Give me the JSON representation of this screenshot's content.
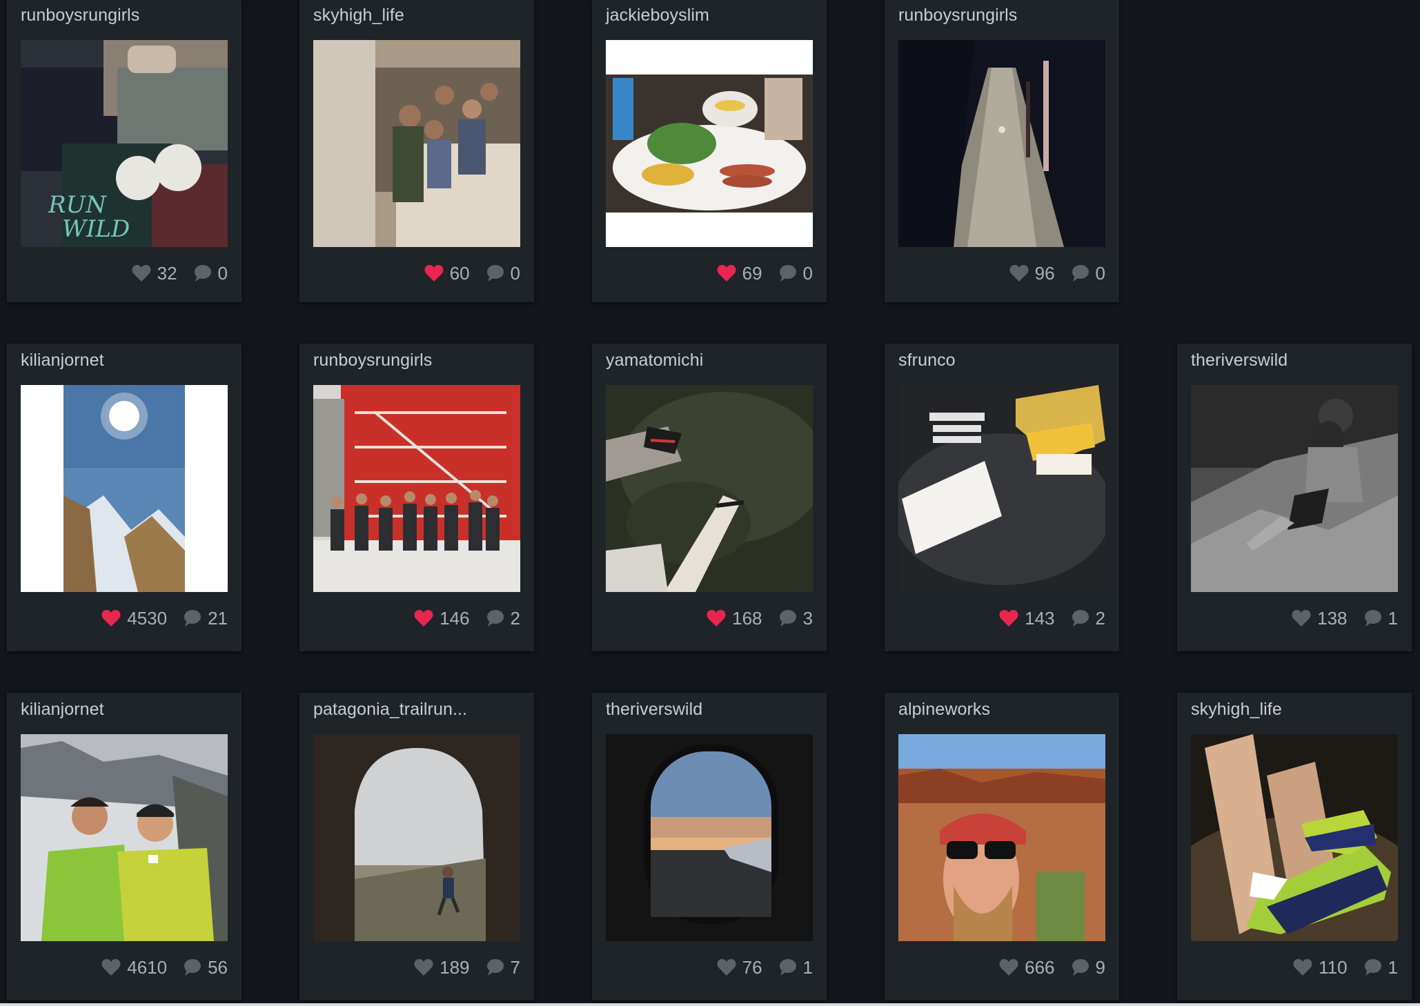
{
  "colors": {
    "background": "#121519",
    "card": "#1f2428",
    "liked_heart": "#e8264f",
    "unliked_heart": "#5c6369",
    "comment_icon": "#5c6369",
    "text": "#c9ced3"
  },
  "posts": [
    {
      "user": "runboysrungirls",
      "likes": "32",
      "comments": "0",
      "liked": false,
      "image": "tshirts-merch-photo"
    },
    {
      "user": "skyhigh_life",
      "likes": "60",
      "comments": "0",
      "liked": true,
      "image": "group-stairwell-photo"
    },
    {
      "user": "jackieboyslim",
      "likes": "69",
      "comments": "0",
      "liked": true,
      "image": "breakfast-plate-photo"
    },
    {
      "user": "runboysrungirls",
      "likes": "96",
      "comments": "0",
      "liked": false,
      "image": "stone-stairs-photo"
    },
    {
      "user": "kilianjornet",
      "likes": "4530",
      "comments": "21",
      "liked": true,
      "image": "snowy-mountain-sun-photo"
    },
    {
      "user": "runboysrungirls",
      "likes": "146",
      "comments": "2",
      "liked": true,
      "image": "red-fire-escape-group-photo"
    },
    {
      "user": "yamatomichi",
      "likes": "168",
      "comments": "3",
      "liked": true,
      "image": "sandal-feet-moss-photo"
    },
    {
      "user": "sfrunco",
      "likes": "143",
      "comments": "2",
      "liked": true,
      "image": "running-company-cards-photo"
    },
    {
      "user": "theriverswild",
      "likes": "138",
      "comments": "1",
      "liked": false,
      "image": "bw-climber-rock-photo"
    },
    {
      "user": "kilianjornet",
      "likes": "4610",
      "comments": "56",
      "liked": false,
      "image": "two-runners-glacier-photo"
    },
    {
      "user": "patagonia_trailrun...",
      "likes": "189",
      "comments": "7",
      "liked": false,
      "image": "cave-runner-photo"
    },
    {
      "user": "theriverswild",
      "likes": "76",
      "comments": "1",
      "liked": false,
      "image": "airplane-window-photo"
    },
    {
      "user": "alpineworks",
      "likes": "666",
      "comments": "9",
      "liked": false,
      "image": "desert-selfie-photo"
    },
    {
      "user": "skyhigh_life",
      "likes": "110",
      "comments": "1",
      "liked": false,
      "image": "green-shoes-photo"
    }
  ]
}
